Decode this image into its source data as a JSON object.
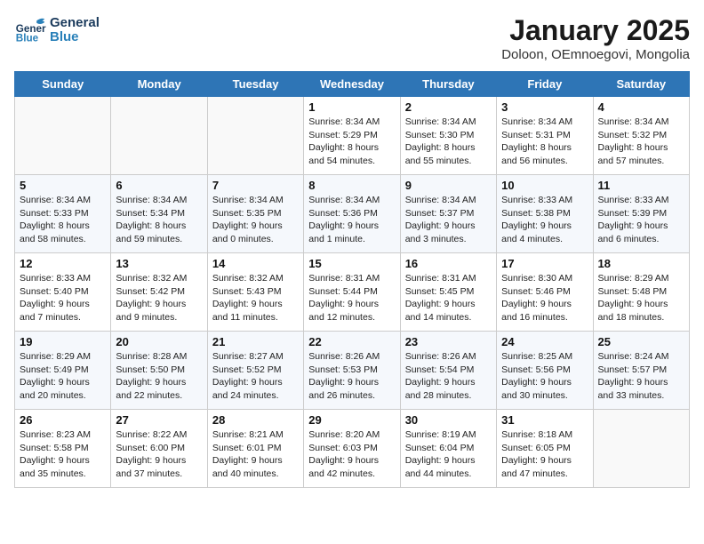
{
  "header": {
    "logo_general": "General",
    "logo_blue": "Blue",
    "month_title": "January 2025",
    "subtitle": "Doloon, OEmnoegovi, Mongolia"
  },
  "days_of_week": [
    "Sunday",
    "Monday",
    "Tuesday",
    "Wednesday",
    "Thursday",
    "Friday",
    "Saturday"
  ],
  "weeks": [
    [
      {
        "day": "",
        "info": ""
      },
      {
        "day": "",
        "info": ""
      },
      {
        "day": "",
        "info": ""
      },
      {
        "day": "1",
        "info": "Sunrise: 8:34 AM\nSunset: 5:29 PM\nDaylight: 8 hours\nand 54 minutes."
      },
      {
        "day": "2",
        "info": "Sunrise: 8:34 AM\nSunset: 5:30 PM\nDaylight: 8 hours\nand 55 minutes."
      },
      {
        "day": "3",
        "info": "Sunrise: 8:34 AM\nSunset: 5:31 PM\nDaylight: 8 hours\nand 56 minutes."
      },
      {
        "day": "4",
        "info": "Sunrise: 8:34 AM\nSunset: 5:32 PM\nDaylight: 8 hours\nand 57 minutes."
      }
    ],
    [
      {
        "day": "5",
        "info": "Sunrise: 8:34 AM\nSunset: 5:33 PM\nDaylight: 8 hours\nand 58 minutes."
      },
      {
        "day": "6",
        "info": "Sunrise: 8:34 AM\nSunset: 5:34 PM\nDaylight: 8 hours\nand 59 minutes."
      },
      {
        "day": "7",
        "info": "Sunrise: 8:34 AM\nSunset: 5:35 PM\nDaylight: 9 hours\nand 0 minutes."
      },
      {
        "day": "8",
        "info": "Sunrise: 8:34 AM\nSunset: 5:36 PM\nDaylight: 9 hours\nand 1 minute."
      },
      {
        "day": "9",
        "info": "Sunrise: 8:34 AM\nSunset: 5:37 PM\nDaylight: 9 hours\nand 3 minutes."
      },
      {
        "day": "10",
        "info": "Sunrise: 8:33 AM\nSunset: 5:38 PM\nDaylight: 9 hours\nand 4 minutes."
      },
      {
        "day": "11",
        "info": "Sunrise: 8:33 AM\nSunset: 5:39 PM\nDaylight: 9 hours\nand 6 minutes."
      }
    ],
    [
      {
        "day": "12",
        "info": "Sunrise: 8:33 AM\nSunset: 5:40 PM\nDaylight: 9 hours\nand 7 minutes."
      },
      {
        "day": "13",
        "info": "Sunrise: 8:32 AM\nSunset: 5:42 PM\nDaylight: 9 hours\nand 9 minutes."
      },
      {
        "day": "14",
        "info": "Sunrise: 8:32 AM\nSunset: 5:43 PM\nDaylight: 9 hours\nand 11 minutes."
      },
      {
        "day": "15",
        "info": "Sunrise: 8:31 AM\nSunset: 5:44 PM\nDaylight: 9 hours\nand 12 minutes."
      },
      {
        "day": "16",
        "info": "Sunrise: 8:31 AM\nSunset: 5:45 PM\nDaylight: 9 hours\nand 14 minutes."
      },
      {
        "day": "17",
        "info": "Sunrise: 8:30 AM\nSunset: 5:46 PM\nDaylight: 9 hours\nand 16 minutes."
      },
      {
        "day": "18",
        "info": "Sunrise: 8:29 AM\nSunset: 5:48 PM\nDaylight: 9 hours\nand 18 minutes."
      }
    ],
    [
      {
        "day": "19",
        "info": "Sunrise: 8:29 AM\nSunset: 5:49 PM\nDaylight: 9 hours\nand 20 minutes."
      },
      {
        "day": "20",
        "info": "Sunrise: 8:28 AM\nSunset: 5:50 PM\nDaylight: 9 hours\nand 22 minutes."
      },
      {
        "day": "21",
        "info": "Sunrise: 8:27 AM\nSunset: 5:52 PM\nDaylight: 9 hours\nand 24 minutes."
      },
      {
        "day": "22",
        "info": "Sunrise: 8:26 AM\nSunset: 5:53 PM\nDaylight: 9 hours\nand 26 minutes."
      },
      {
        "day": "23",
        "info": "Sunrise: 8:26 AM\nSunset: 5:54 PM\nDaylight: 9 hours\nand 28 minutes."
      },
      {
        "day": "24",
        "info": "Sunrise: 8:25 AM\nSunset: 5:56 PM\nDaylight: 9 hours\nand 30 minutes."
      },
      {
        "day": "25",
        "info": "Sunrise: 8:24 AM\nSunset: 5:57 PM\nDaylight: 9 hours\nand 33 minutes."
      }
    ],
    [
      {
        "day": "26",
        "info": "Sunrise: 8:23 AM\nSunset: 5:58 PM\nDaylight: 9 hours\nand 35 minutes."
      },
      {
        "day": "27",
        "info": "Sunrise: 8:22 AM\nSunset: 6:00 PM\nDaylight: 9 hours\nand 37 minutes."
      },
      {
        "day": "28",
        "info": "Sunrise: 8:21 AM\nSunset: 6:01 PM\nDaylight: 9 hours\nand 40 minutes."
      },
      {
        "day": "29",
        "info": "Sunrise: 8:20 AM\nSunset: 6:03 PM\nDaylight: 9 hours\nand 42 minutes."
      },
      {
        "day": "30",
        "info": "Sunrise: 8:19 AM\nSunset: 6:04 PM\nDaylight: 9 hours\nand 44 minutes."
      },
      {
        "day": "31",
        "info": "Sunrise: 8:18 AM\nSunset: 6:05 PM\nDaylight: 9 hours\nand 47 minutes."
      },
      {
        "day": "",
        "info": ""
      }
    ]
  ]
}
